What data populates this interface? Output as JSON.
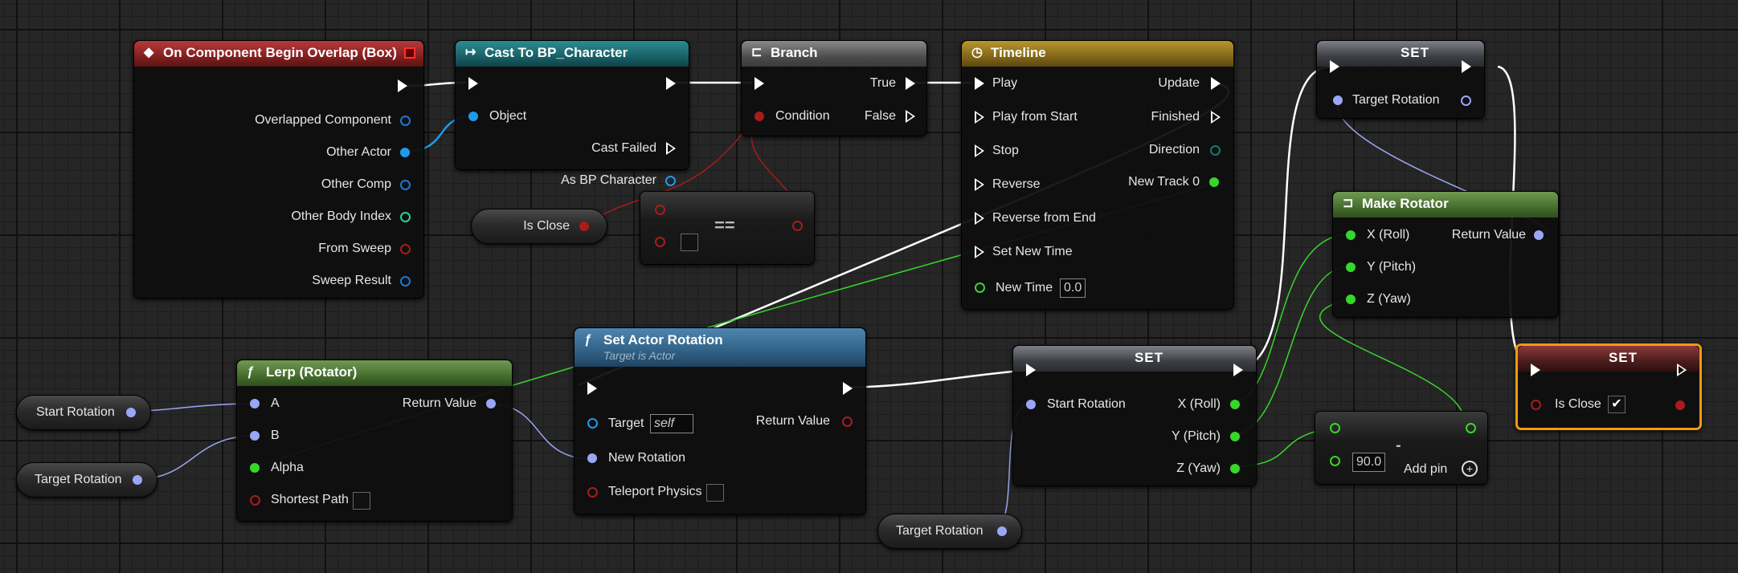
{
  "colors": {
    "exec": "#ffffff",
    "rotator": "#9aa6f5",
    "float": "#36d62b",
    "bool": "#a81c1c",
    "object": "#1e9bea",
    "struct": "#1a78d6",
    "int": "#21d49b",
    "selected": "#f29a0d"
  },
  "events": {
    "begin_overlap": {
      "title": "On Component Begin Overlap (Box)",
      "pins": [
        "Overlapped Component",
        "Other Actor",
        "Other Comp",
        "Other Body Index",
        "From Sweep",
        "Sweep Result"
      ]
    }
  },
  "cast": {
    "title": "Cast To BP_Character",
    "object": "Object",
    "cast_failed": "Cast Failed",
    "as_character": "As BP Character"
  },
  "branch": {
    "title": "Branch",
    "condition": "Condition",
    "true": "True",
    "false": "False"
  },
  "timeline": {
    "title": "Timeline",
    "inputs": [
      "Play",
      "Play from Start",
      "Stop",
      "Reverse",
      "Reverse from End",
      "Set New Time",
      "New Time"
    ],
    "new_time_value": "0.0",
    "outputs": [
      "Update",
      "Finished",
      "Direction",
      "New Track 0"
    ]
  },
  "set_rotation_top": {
    "title": "SET",
    "pin": "Target Rotation"
  },
  "make_rotator": {
    "title": "Make Rotator",
    "inputs": [
      "X (Roll)",
      "Y (Pitch)",
      "Z (Yaw)"
    ],
    "output": "Return Value"
  },
  "is_close_var": {
    "label": "Is Close"
  },
  "equals": {
    "symbol": "=="
  },
  "set_actor_rotation": {
    "title": "Set Actor Rotation",
    "subtitle": "Target is Actor",
    "target": "Target",
    "target_value": "self",
    "new_rotation": "New Rotation",
    "teleport": "Teleport Physics",
    "return_value": "Return Value"
  },
  "lerp": {
    "title": "Lerp (Rotator)",
    "a": "A",
    "b": "B",
    "alpha": "Alpha",
    "shortest": "Shortest Path",
    "return_value": "Return Value"
  },
  "vars": {
    "start_rotation": "Start Rotation",
    "target_rotation_1": "Target Rotation",
    "target_rotation_2": "Target Rotation"
  },
  "set_start": {
    "title": "SET",
    "pin": "Start Rotation",
    "outputs": [
      "X (Roll)",
      "Y (Pitch)",
      "Z (Yaw)"
    ]
  },
  "subtract": {
    "symbol": "-",
    "value": "90.0",
    "add_pin": "Add pin"
  },
  "set_is_close": {
    "title": "SET",
    "pin": "Is Close",
    "checked": true
  }
}
